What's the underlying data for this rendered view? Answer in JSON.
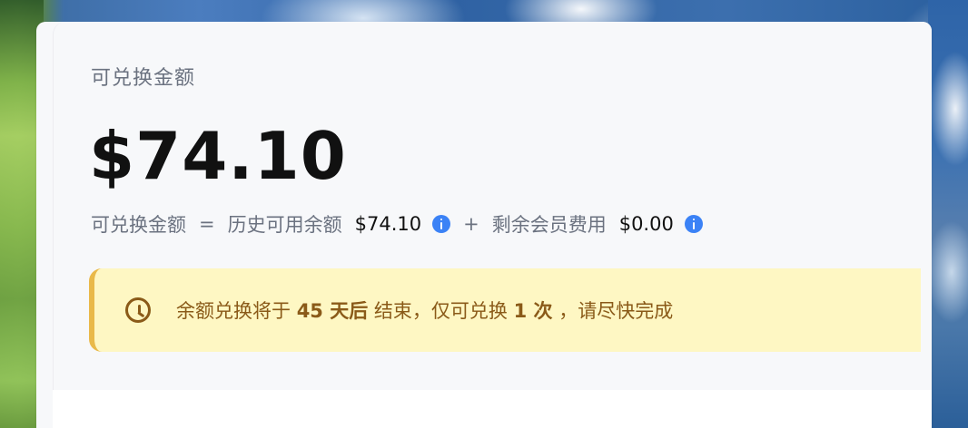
{
  "card": {
    "title": "可兑换金额",
    "amount": "$74.10",
    "formula": {
      "left_label": "可兑换金额",
      "equals": "=",
      "term1_label": "历史可用余额",
      "term1_value": "$74.10",
      "plus": "+",
      "term2_label": "剩余会员费用",
      "term2_value": "$0.00"
    },
    "notice": {
      "prefix": "余额兑换将于 ",
      "days": "45 天后",
      "middle": "结束，仅可兑换 ",
      "times": "1 次",
      "suffix": "，请尽快完成"
    }
  },
  "icons": {
    "info": "info-icon",
    "clock": "clock-icon"
  },
  "colors": {
    "info_blue": "#3b82f6",
    "notice_bg": "#fef7c3",
    "notice_border": "#e9b949",
    "notice_text": "#8a5a18",
    "muted_text": "#6b7280",
    "strong_text": "#111111"
  }
}
